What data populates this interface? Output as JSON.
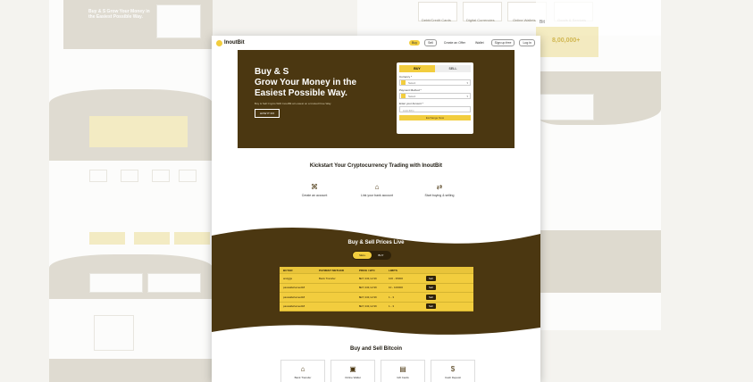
{
  "nav": {
    "brand": "InoutBit",
    "links": [
      "Buy",
      "Sell",
      "Create an Offer",
      "Wallet",
      "Sign up free",
      "Log in"
    ]
  },
  "hero": {
    "title_line1": "Buy & S",
    "title_line2": "Grow Your Money in the",
    "title_line3": "Easiest Possible Way.",
    "subtitle": "Buy & Sell Crypto With InoutBit at Lowest on a trusted Free Way.",
    "cta": "HOW IT FIX",
    "form": {
      "tab_buy": "BUY",
      "tab_sell": "SELL",
      "currency_label": "Currency *",
      "currency_value": "Select",
      "payment_label": "Payment Method *",
      "payment_value": "Select",
      "amount_label": "Enter your Amount *",
      "amount_placeholder": "0.00 BTC",
      "exchange_button": "Exchange Now"
    }
  },
  "kickstart": {
    "title": "Kickstart Your Cryptocurrency Trading with InoutBit",
    "steps": [
      {
        "label": "Create an account",
        "icon": "fingerprint-icon"
      },
      {
        "label": "Link your bank account",
        "icon": "bank-icon"
      },
      {
        "label": "Start buying & selling",
        "icon": "exchange-arrows-icon"
      }
    ]
  },
  "prices": {
    "title": "Buy & Sell Prices Live",
    "tab_active": "SELL",
    "tab_inactive": "BUY",
    "headers": [
      "BUYER",
      "PAYMENT METHOD",
      "PRICE / BTC",
      "LIMITS",
      ""
    ],
    "rows": [
      {
        "buyer": "andyjjjs",
        "method": "Bank Transfer",
        "price": "₦27,443,12.99",
        "limits": "100 - 35000",
        "action": "Sell"
      },
      {
        "buyer": "paswallehamed18",
        "method": "",
        "price": "₦27,443,12.99",
        "limits": "10 - 100000",
        "action": "Sell"
      },
      {
        "buyer": "paswallehamed18",
        "method": "",
        "price": "₦27,443,12.99",
        "limits": "1 - 3",
        "action": "Sell"
      },
      {
        "buyer": "paswallehamed18",
        "method": "",
        "price": "₦27,443,12.99",
        "limits": "1 - 3",
        "action": "Sell"
      }
    ]
  },
  "buy_sell_bitcoin": {
    "title": "Buy and Sell Bitcoin",
    "cards": [
      {
        "label": "Bank Transfer",
        "icon": "bank-icon"
      },
      {
        "label": "Online Wallet",
        "icon": "wallet-icon"
      },
      {
        "label": "Gift Cards",
        "icon": "gift-card-icon"
      },
      {
        "label": "Cash Deposit",
        "icon": "cash-icon"
      }
    ]
  },
  "background": {
    "left_hero": "Buy & S Grow Your Money in the Easiest Possible Way.",
    "right_stat": "8,00,000+",
    "right_brand": "Bit",
    "top_tabs": [
      "Debit/Credit Cards",
      "Digital Currencies",
      "Online Wallets",
      "Goods & Services"
    ]
  },
  "colors": {
    "accent": "#f2cd3e",
    "dark_brown": "#4b3711",
    "ghost_beige": "#d9d4c8"
  }
}
